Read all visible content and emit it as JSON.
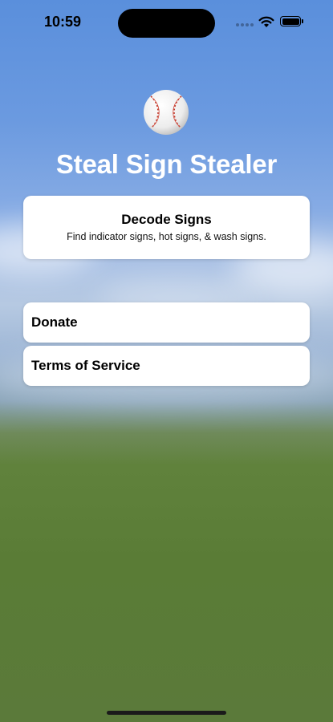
{
  "status": {
    "time": "10:59",
    "icons": [
      "cellular-signal-icon",
      "wifi-icon",
      "battery-icon"
    ]
  },
  "app": {
    "logo_icon": "baseball-icon",
    "title": "Steal Sign Stealer"
  },
  "decode": {
    "title": "Decode Signs",
    "subtitle": "Find indicator signs, hot signs, & wash signs."
  },
  "menu": {
    "donate_label": "Donate",
    "terms_label": "Terms of Service"
  },
  "colors": {
    "sky": "#6b9ae0",
    "grass": "#5a7c36",
    "card": "#ffffff",
    "title_text": "#ffffff",
    "stitch": "#c0392b"
  }
}
